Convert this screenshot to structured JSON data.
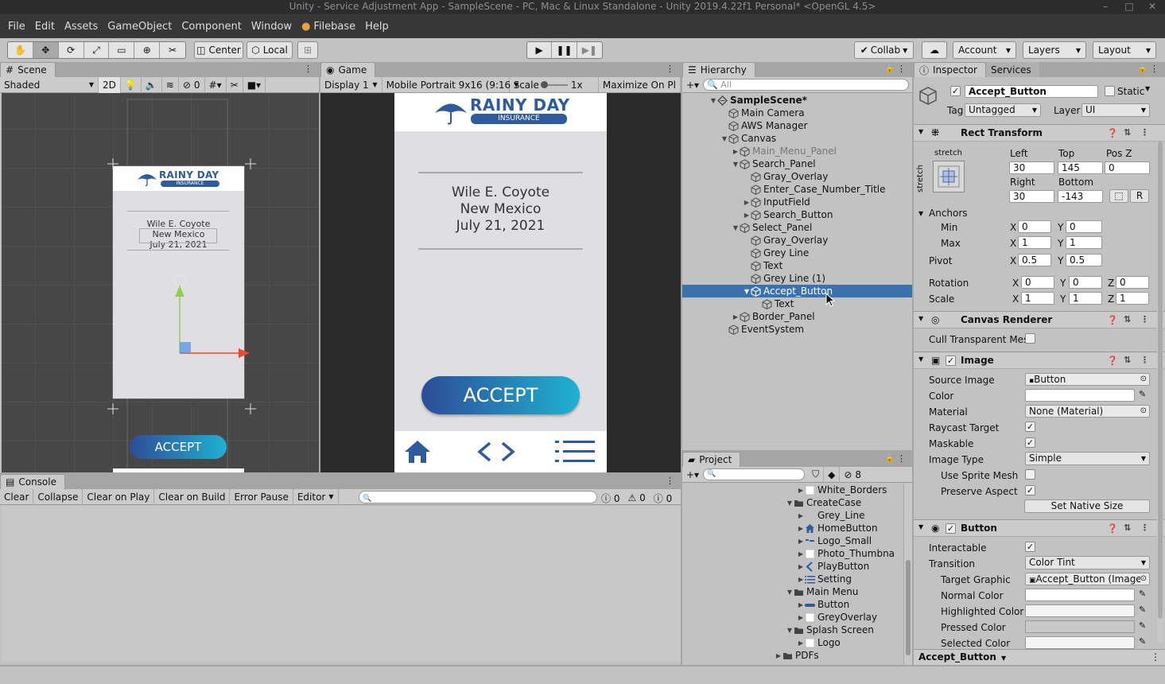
{
  "window": {
    "title": "Unity - Service Adjustment App - SampleScene - PC, Mac & Linux Standalone - Unity 2019.4.22f1 Personal* <OpenGL 4.5>"
  },
  "menu": [
    "File",
    "Edit",
    "Assets",
    "GameObject",
    "Component",
    "Window",
    "Filebase",
    "Help"
  ],
  "toolbar": {
    "center": "Center",
    "local": "Local",
    "collab": "Collab",
    "account": "Account",
    "layers": "Layers",
    "layout": "Layout"
  },
  "scene": {
    "tab": "Scene",
    "shading": "Shaded",
    "mode2d": "2D",
    "hidden_count": "0",
    "preview": {
      "brand_line1": "RAINY DAY",
      "brand_line2": "INSURANCE",
      "name": "Wile E. Coyote",
      "state": "New Mexico",
      "date": "July 21, 2021",
      "button": "ACCEPT"
    }
  },
  "game": {
    "tab": "Game",
    "display": "Display 1",
    "resolution": "Mobile Portrait 9x16 (9:16",
    "scale_label": "Scale",
    "scale_value": "1x",
    "maximize": "Maximize On Pl",
    "brand_line1": "RAINY DAY",
    "brand_line2": "INSURANCE",
    "name": "Wile E. Coyote",
    "state": "New Mexico",
    "date": "July 21, 2021",
    "button": "ACCEPT"
  },
  "hierarchy": {
    "tab": "Hierarchy",
    "search_placeholder": "All",
    "items": [
      {
        "label": "SampleScene*",
        "depth": 0,
        "arrow": "down",
        "icon": "scene"
      },
      {
        "label": "Main Camera",
        "depth": 1,
        "arrow": "",
        "icon": "cube"
      },
      {
        "label": "AWS Manager",
        "depth": 1,
        "arrow": "",
        "icon": "cube"
      },
      {
        "label": "Canvas",
        "depth": 1,
        "arrow": "down",
        "icon": "cube"
      },
      {
        "label": "Main_Menu_Panel",
        "depth": 2,
        "arrow": "right",
        "icon": "cube",
        "dim": true
      },
      {
        "label": "Search_Panel",
        "depth": 2,
        "arrow": "down",
        "icon": "cube"
      },
      {
        "label": "Gray_Overlay",
        "depth": 3,
        "arrow": "",
        "icon": "cube"
      },
      {
        "label": "Enter_Case_Number_Title",
        "depth": 3,
        "arrow": "",
        "icon": "cube"
      },
      {
        "label": "InputField",
        "depth": 3,
        "arrow": "right",
        "icon": "cube"
      },
      {
        "label": "Search_Button",
        "depth": 3,
        "arrow": "right",
        "icon": "cube"
      },
      {
        "label": "Select_Panel",
        "depth": 2,
        "arrow": "down",
        "icon": "cube"
      },
      {
        "label": "Gray_Overlay",
        "depth": 3,
        "arrow": "",
        "icon": "cube"
      },
      {
        "label": "Grey Line",
        "depth": 3,
        "arrow": "",
        "icon": "cube"
      },
      {
        "label": "Text",
        "depth": 3,
        "arrow": "",
        "icon": "cube"
      },
      {
        "label": "Grey Line (1)",
        "depth": 3,
        "arrow": "",
        "icon": "cube"
      },
      {
        "label": "Accept_Button",
        "depth": 3,
        "arrow": "down",
        "icon": "cube",
        "selected": true
      },
      {
        "label": "Text",
        "depth": 4,
        "arrow": "",
        "icon": "cube"
      },
      {
        "label": "Border_Panel",
        "depth": 2,
        "arrow": "right",
        "icon": "cube"
      },
      {
        "label": "EventSystem",
        "depth": 1,
        "arrow": "",
        "icon": "cube"
      }
    ]
  },
  "project": {
    "tab": "Project",
    "badge": "8",
    "items": [
      {
        "label": "White_Borders",
        "depth": 2,
        "arrow": "right",
        "icon": "white"
      },
      {
        "label": "CreateCase",
        "depth": 1,
        "arrow": "down",
        "icon": "folder"
      },
      {
        "label": "Grey_Line",
        "depth": 2,
        "arrow": "right",
        "icon": "none"
      },
      {
        "label": "HomeButton",
        "depth": 2,
        "arrow": "right",
        "icon": "home"
      },
      {
        "label": "Logo_Small",
        "depth": 2,
        "arrow": "right",
        "icon": "logo"
      },
      {
        "label": "Photo_Thumbna",
        "depth": 2,
        "arrow": "right",
        "icon": "white"
      },
      {
        "label": "PlayButton",
        "depth": 2,
        "arrow": "right",
        "icon": "play"
      },
      {
        "label": "Setting",
        "depth": 2,
        "arrow": "right",
        "icon": "list"
      },
      {
        "label": "Main Menu",
        "depth": 1,
        "arrow": "down",
        "icon": "folder"
      },
      {
        "label": "Button",
        "depth": 2,
        "arrow": "right",
        "icon": "btn"
      },
      {
        "label": "GreyOverlay",
        "depth": 2,
        "arrow": "right",
        "icon": "white"
      },
      {
        "label": "Splash Screen",
        "depth": 1,
        "arrow": "down",
        "icon": "folder"
      },
      {
        "label": "Logo",
        "depth": 2,
        "arrow": "right",
        "icon": "white"
      },
      {
        "label": "PDFs",
        "depth": 0,
        "arrow": "right",
        "icon": "folder"
      }
    ]
  },
  "console": {
    "tab": "Console",
    "buttons": [
      "Clear",
      "Collapse",
      "Clear on Play",
      "Clear on Build",
      "Error Pause",
      "Editor"
    ],
    "info_count": "0",
    "warn_count": "0",
    "error_count": "0"
  },
  "inspector": {
    "tab": "Inspector",
    "tab2": "Services",
    "object_name": "Accept_Button",
    "static_label": "Static",
    "tag_label": "Tag",
    "tag_value": "Untagged",
    "layer_label": "Layer",
    "layer_value": "UI",
    "rect": {
      "title": "Rect Transform",
      "stretch_h": "stretch",
      "stretch_v": "stretch",
      "left_label": "Left",
      "top_label": "Top",
      "posz_label": "Pos Z",
      "left": "30",
      "top": "145",
      "posz": "0",
      "right_label": "Right",
      "bottom_label": "Bottom",
      "right": "30",
      "bottom": "-143",
      "r_btn": "R",
      "anchors": "Anchors",
      "min": "Min",
      "max": "Max",
      "min_x": "0",
      "min_y": "0",
      "max_x": "1",
      "max_y": "1",
      "pivot": "Pivot",
      "pivot_x": "0.5",
      "pivot_y": "0.5",
      "rotation": "Rotation",
      "rot_x": "0",
      "rot_y": "0",
      "rot_z": "0",
      "scale": "Scale",
      "scale_x": "1",
      "scale_y": "1",
      "scale_z": "1"
    },
    "canvas_renderer": {
      "title": "Canvas Renderer",
      "cull": "Cull Transparent Mes"
    },
    "image": {
      "title": "Image",
      "source_label": "Source Image",
      "source": "Button",
      "color_label": "Color",
      "material_label": "Material",
      "material": "None (Material)",
      "raycast": "Raycast Target",
      "maskable": "Maskable",
      "type_label": "Image Type",
      "type": "Simple",
      "sprite_mesh": "Use Sprite Mesh",
      "preserve": "Preserve Aspect",
      "native": "Set Native Size"
    },
    "button": {
      "title": "Button",
      "interactable": "Interactable",
      "transition_label": "Transition",
      "transition": "Color Tint",
      "target_label": "Target Graphic",
      "target": "Accept_Button (Image",
      "normal": "Normal Color",
      "highlighted": "Highlighted Color",
      "pressed": "Pressed Color",
      "selected": "Selected Color"
    },
    "footer": "Accept_Button"
  },
  "colors": {
    "brand": "#2d5b9c",
    "selection": "#3a72b0",
    "accent": "#1fb1d2"
  },
  "icons": [
    "hand-icon",
    "move-icon",
    "rotate-icon",
    "scale-icon",
    "rect-icon",
    "transform-icon",
    "custom-tool-icon",
    "play-icon",
    "pause-icon",
    "step-icon",
    "cloud-icon",
    "umbrella-icon",
    "home-icon",
    "code-icon",
    "list-icon"
  ]
}
